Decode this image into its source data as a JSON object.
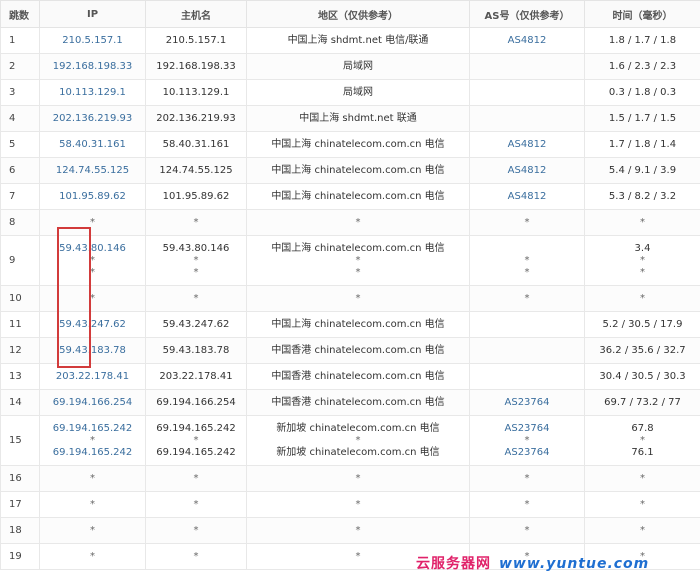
{
  "headers": {
    "hop": "跳数",
    "ip": "IP",
    "host": "主机名",
    "loc": "地区（仅供参考）",
    "as": "AS号（仅供参考）",
    "time": "时间（毫秒）"
  },
  "rows": [
    {
      "hop": "1",
      "ip": [
        "210.5.157.1"
      ],
      "host": [
        "210.5.157.1"
      ],
      "loc": [
        "中国上海 shdmt.net 电信/联通"
      ],
      "as": [
        "AS4812"
      ],
      "time": [
        "1.8 / 1.7 / 1.8"
      ]
    },
    {
      "hop": "2",
      "ip": [
        "192.168.198.33"
      ],
      "host": [
        "192.168.198.33"
      ],
      "loc": [
        "局域网"
      ],
      "as": [
        ""
      ],
      "time": [
        "1.6 / 2.3 / 2.3"
      ]
    },
    {
      "hop": "3",
      "ip": [
        "10.113.129.1"
      ],
      "host": [
        "10.113.129.1"
      ],
      "loc": [
        "局域网"
      ],
      "as": [
        ""
      ],
      "time": [
        "0.3 / 1.8 / 0.3"
      ]
    },
    {
      "hop": "4",
      "ip": [
        "202.136.219.93"
      ],
      "host": [
        "202.136.219.93"
      ],
      "loc": [
        "中国上海 shdmt.net 联通"
      ],
      "as": [
        ""
      ],
      "time": [
        "1.5 / 1.7 / 1.5"
      ]
    },
    {
      "hop": "5",
      "ip": [
        "58.40.31.161"
      ],
      "host": [
        "58.40.31.161"
      ],
      "loc": [
        "中国上海 chinatelecom.com.cn 电信"
      ],
      "as": [
        "AS4812"
      ],
      "time": [
        "1.7 / 1.8 / 1.4"
      ]
    },
    {
      "hop": "6",
      "ip": [
        "124.74.55.125"
      ],
      "host": [
        "124.74.55.125"
      ],
      "loc": [
        "中国上海 chinatelecom.com.cn 电信"
      ],
      "as": [
        "AS4812"
      ],
      "time": [
        "5.4 / 9.1 / 3.9"
      ]
    },
    {
      "hop": "7",
      "ip": [
        "101.95.89.62"
      ],
      "host": [
        "101.95.89.62"
      ],
      "loc": [
        "中国上海 chinatelecom.com.cn 电信"
      ],
      "as": [
        "AS4812"
      ],
      "time": [
        "5.3 / 8.2 / 3.2"
      ]
    },
    {
      "hop": "8",
      "ip": [
        "*"
      ],
      "host": [
        "*"
      ],
      "loc": [
        "*"
      ],
      "as": [
        "*"
      ],
      "time": [
        "*"
      ]
    },
    {
      "hop": "9",
      "ip": [
        "59.43.80.146",
        "*",
        "*"
      ],
      "host": [
        "59.43.80.146",
        "*",
        "*"
      ],
      "loc": [
        "中国上海 chinatelecom.com.cn 电信",
        "*",
        "*"
      ],
      "as": [
        "",
        "*",
        "*"
      ],
      "time": [
        "3.4",
        "*",
        "*"
      ]
    },
    {
      "hop": "10",
      "ip": [
        "*"
      ],
      "host": [
        "*"
      ],
      "loc": [
        "*"
      ],
      "as": [
        "*"
      ],
      "time": [
        "*"
      ]
    },
    {
      "hop": "11",
      "ip": [
        "59.43.247.62"
      ],
      "host": [
        "59.43.247.62"
      ],
      "loc": [
        "中国上海 chinatelecom.com.cn 电信"
      ],
      "as": [
        ""
      ],
      "time": [
        "5.2 / 30.5 / 17.9"
      ]
    },
    {
      "hop": "12",
      "ip": [
        "59.43.183.78"
      ],
      "host": [
        "59.43.183.78"
      ],
      "loc": [
        "中国香港 chinatelecom.com.cn 电信"
      ],
      "as": [
        ""
      ],
      "time": [
        "36.2 / 35.6 / 32.7"
      ]
    },
    {
      "hop": "13",
      "ip": [
        "203.22.178.41"
      ],
      "host": [
        "203.22.178.41"
      ],
      "loc": [
        "中国香港 chinatelecom.com.cn 电信"
      ],
      "as": [
        ""
      ],
      "time": [
        "30.4 / 30.5 / 30.3"
      ]
    },
    {
      "hop": "14",
      "ip": [
        "69.194.166.254"
      ],
      "host": [
        "69.194.166.254"
      ],
      "loc": [
        "中国香港 chinatelecom.com.cn 电信"
      ],
      "as": [
        "AS23764"
      ],
      "time": [
        "69.7 / 73.2 / 77"
      ]
    },
    {
      "hop": "15",
      "ip": [
        "69.194.165.242",
        "*",
        "69.194.165.242"
      ],
      "host": [
        "69.194.165.242",
        "*",
        "69.194.165.242"
      ],
      "loc": [
        "新加坡 chinatelecom.com.cn 电信",
        "*",
        "新加坡 chinatelecom.com.cn 电信"
      ],
      "as": [
        "AS23764",
        "*",
        "AS23764"
      ],
      "time": [
        "67.8",
        "*",
        "76.1"
      ]
    },
    {
      "hop": "16",
      "ip": [
        "*"
      ],
      "host": [
        "*"
      ],
      "loc": [
        "*"
      ],
      "as": [
        "*"
      ],
      "time": [
        "*"
      ]
    },
    {
      "hop": "17",
      "ip": [
        "*"
      ],
      "host": [
        "*"
      ],
      "loc": [
        "*"
      ],
      "as": [
        "*"
      ],
      "time": [
        "*"
      ]
    },
    {
      "hop": "18",
      "ip": [
        "*"
      ],
      "host": [
        "*"
      ],
      "loc": [
        "*"
      ],
      "as": [
        "*"
      ],
      "time": [
        "*"
      ]
    },
    {
      "hop": "19",
      "ip": [
        "*"
      ],
      "host": [
        "*"
      ],
      "loc": [
        "*"
      ],
      "as": [
        "*"
      ],
      "time": [
        "*"
      ]
    }
  ],
  "watermark": {
    "cn": "云服务器网",
    "en": "www.yuntue.com"
  },
  "colors": {
    "link": "#3a6e9e",
    "highlight": "#d23b3b",
    "watermark_cn": "#e0226a",
    "watermark_en": "#1f6fd1"
  }
}
